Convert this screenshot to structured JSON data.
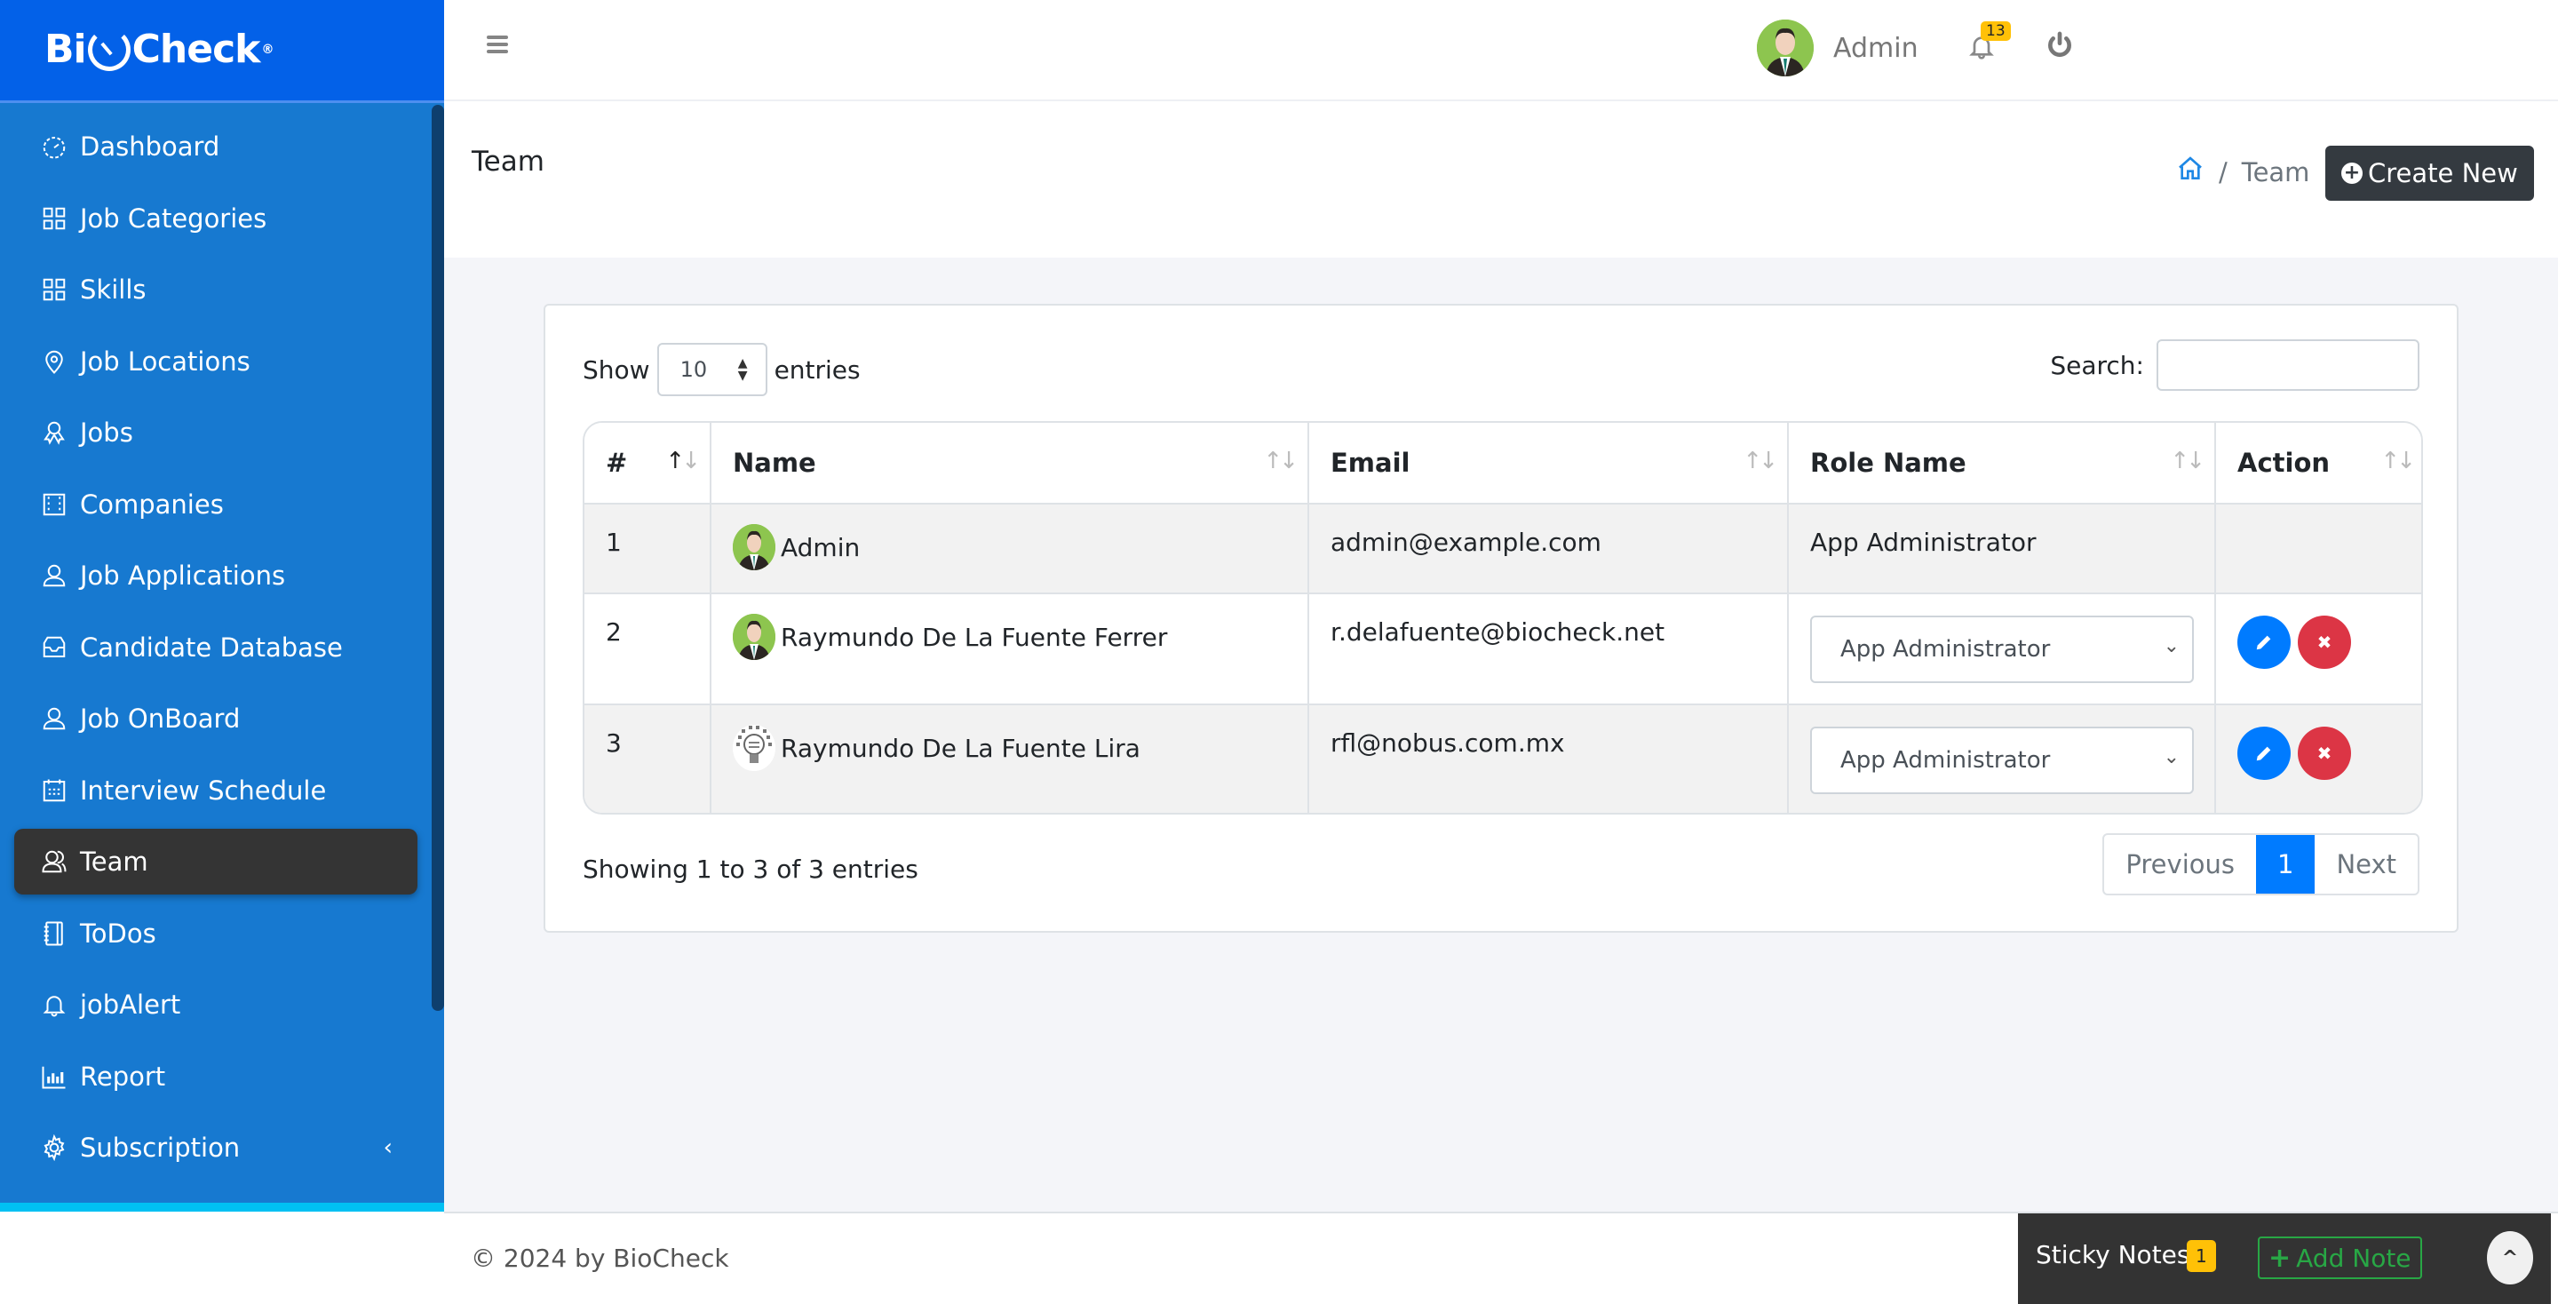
{
  "brand": {
    "logo_text_left": "Bi",
    "logo_text_right": "Check",
    "registered": "®"
  },
  "colors": {
    "sidebar_bg": "#1779d0",
    "logo_bg": "#0361e8",
    "active_item_bg": "#343434",
    "primary": "#007bff",
    "danger": "#dc3545",
    "warning": "#ffc107",
    "success": "#28a745",
    "dark_button": "#343a40"
  },
  "sidebar": {
    "items": [
      {
        "label": "Dashboard",
        "icon": "dashboard-gauge-icon"
      },
      {
        "label": "Job Categories",
        "icon": "grid-icon"
      },
      {
        "label": "Skills",
        "icon": "grid-icon"
      },
      {
        "label": "Job Locations",
        "icon": "map-pin-icon"
      },
      {
        "label": "Jobs",
        "icon": "award-icon"
      },
      {
        "label": "Companies",
        "icon": "film-icon"
      },
      {
        "label": "Job Applications",
        "icon": "user-icon"
      },
      {
        "label": "Candidate Database",
        "icon": "inbox-icon"
      },
      {
        "label": "Job OnBoard",
        "icon": "user-icon"
      },
      {
        "label": "Interview Schedule",
        "icon": "calendar-icon"
      },
      {
        "label": "Team",
        "icon": "users-icon",
        "active": true
      },
      {
        "label": "ToDos",
        "icon": "notebook-icon"
      },
      {
        "label": "jobAlert",
        "icon": "bell-icon"
      },
      {
        "label": "Report",
        "icon": "bar-chart-icon"
      },
      {
        "label": "Subscription",
        "icon": "gear-icon",
        "has_submenu": true
      }
    ],
    "submenu_chevron": "‹"
  },
  "header": {
    "user_name": "Admin",
    "notification_count": "13"
  },
  "page": {
    "title": "Team",
    "breadcrumb": {
      "separator": "/",
      "current": "Team"
    },
    "create_button": "Create New"
  },
  "table_controls": {
    "show_label": "Show",
    "entries_label": "entries",
    "page_length": "10",
    "search_label": "Search:",
    "search_value": "",
    "search_placeholder": ""
  },
  "table": {
    "columns": [
      "#",
      "Name",
      "Email",
      "Role Name",
      "Action"
    ],
    "rows": [
      {
        "num": "1",
        "name": "Admin",
        "avatar": "man-avatar",
        "email": "admin@example.com",
        "role": "App Administrator",
        "role_editable": false,
        "actions": false
      },
      {
        "num": "2",
        "name": "Raymundo De La Fuente Ferrer",
        "avatar": "man-avatar",
        "email": "r.delafuente@biocheck.net",
        "role": "App Administrator",
        "role_editable": true,
        "actions": true
      },
      {
        "num": "3",
        "name": "Raymundo De La Fuente Lira",
        "avatar": "lightbulb-avatar",
        "email": "rfl@nobus.com.mx",
        "role": "App Administrator",
        "role_editable": true,
        "actions": true
      }
    ]
  },
  "pagination": {
    "info": "Showing 1 to 3 of 3 entries",
    "previous": "Previous",
    "current_page": "1",
    "next": "Next"
  },
  "footer": {
    "copyright": "© 2024 by BioCheck"
  },
  "sticky_notes": {
    "label": "Sticky Notes",
    "count": "1",
    "add_label": "Add Note"
  }
}
